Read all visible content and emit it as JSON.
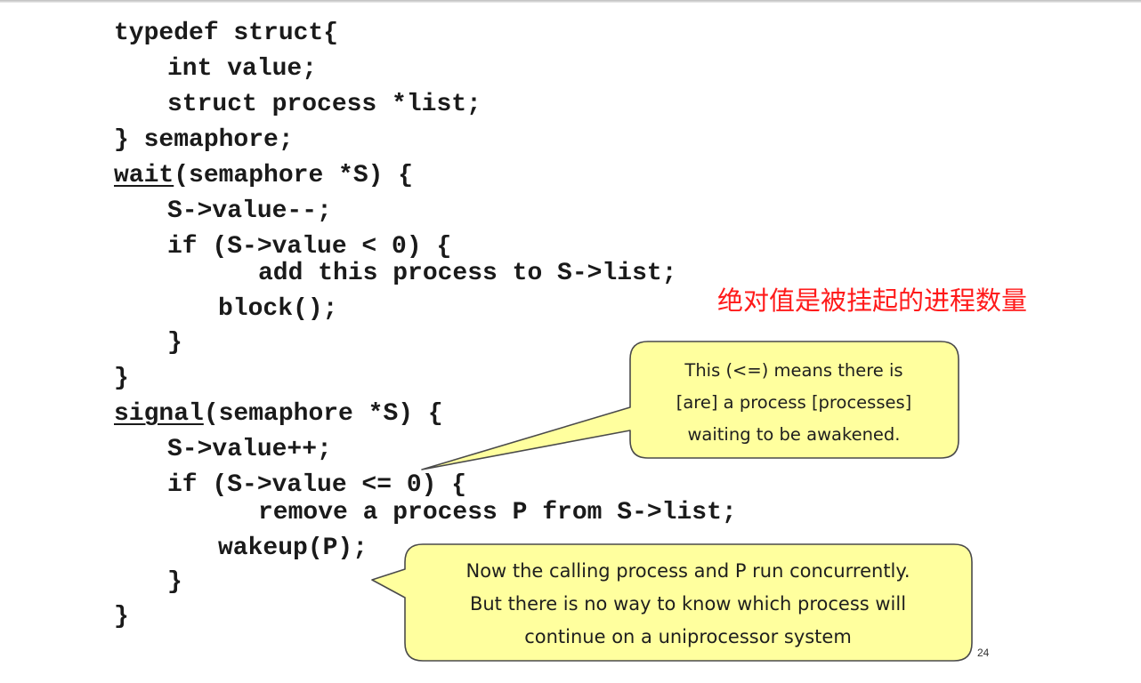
{
  "code": {
    "line1": "typedef struct{",
    "line2": "int value;",
    "line3": "struct process *list;",
    "line4": "} semaphore;",
    "wait_name": "wait",
    "wait_sig": "(semaphore *S) {",
    "line6": "S->value--;",
    "line7": "if (S->value < 0) {",
    "line8": "add this process to S->list;",
    "line9": "block();",
    "line10": "}",
    "line11": "}",
    "signal_name": "signal",
    "signal_sig": "(semaphore *S) {",
    "line13": "S->value++;",
    "line14": "if (S->value <= 0) {",
    "line15": "remove a process P from S->list;",
    "line16": "wakeup(P);",
    "line17": "}",
    "line18": "}"
  },
  "annotation_red": "绝对值是被挂起的进程数量",
  "callout1": {
    "line1": "This (<=) means there is",
    "line2": "[are] a process [processes]",
    "line3": "waiting to be awakened."
  },
  "callout2": {
    "line1": "Now the calling process and P run concurrently.",
    "line2": "But there is no way to know which process will",
    "line3": "continue on a uniprocessor system"
  },
  "page_number": "24",
  "colors": {
    "callout_fill": "#ffff9e",
    "callout_border": "#4a4a4a",
    "annotation": "#ff1a1a",
    "code": "#1a1a1a"
  }
}
